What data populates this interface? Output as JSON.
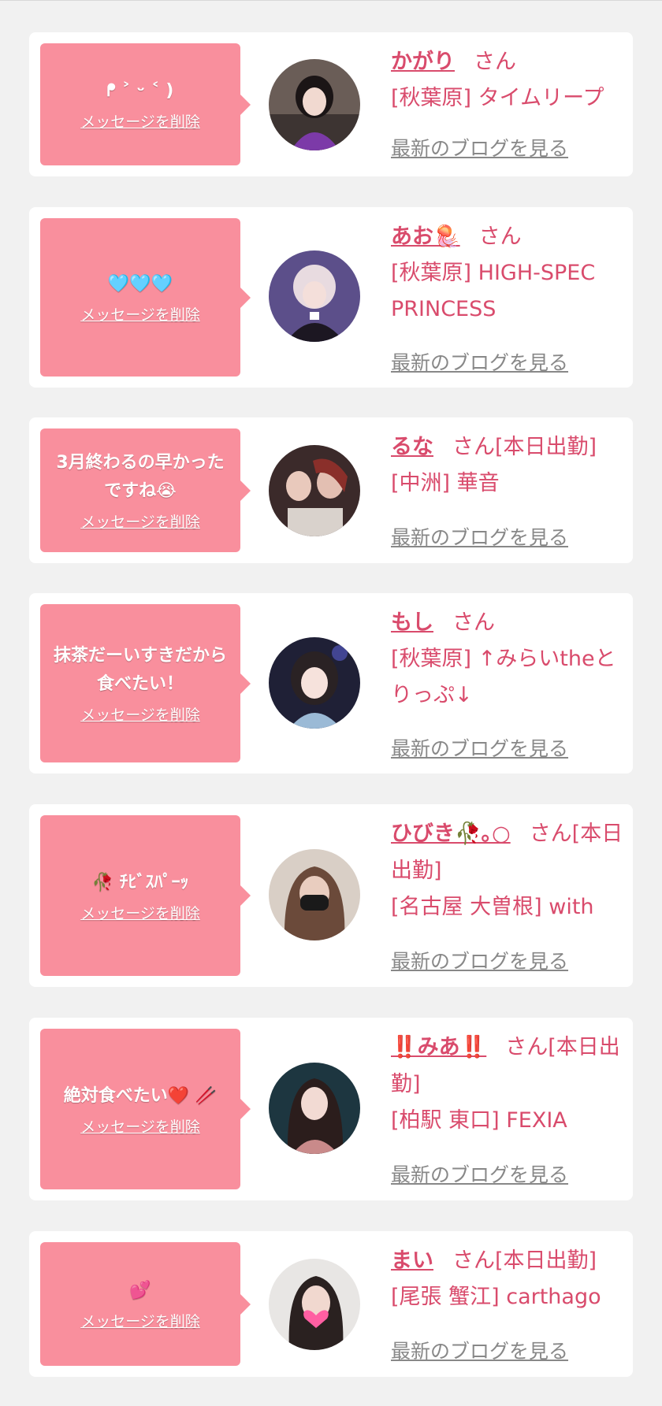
{
  "delete_label": "メッセージを削除",
  "blog_label": "最新のブログを見る",
  "colors": {
    "page_bg": "#f1f1f1",
    "card_bg": "#ffffff",
    "bubble": "#f98f9d",
    "name": "#d94b6c",
    "link": "#888888"
  },
  "entries": [
    {
      "message": "ᖰ ˃ ᵕ ˂ )",
      "name": "かがり",
      "suffix": "さん",
      "shop": "[秋葉原] タイムリープ"
    },
    {
      "message": "🩵🩵🩵",
      "name": "あお🪼",
      "suffix": "さん",
      "shop": "[秋葉原] HIGH-SPEC PRINCESS"
    },
    {
      "message": "3月終わるの早かったですね😭",
      "name": "るな",
      "suffix": "さん[本日出勤]",
      "shop": "[中洲] 華音"
    },
    {
      "message": "抹茶だーいすきだから食べたい！",
      "name": "もし",
      "suffix": "さん",
      "shop": "[秋葉原] ↑みらいtheとりっぷ↓"
    },
    {
      "message": "🥀 ﾁﾋﾞｽﾊﾟｰｯ",
      "name": "ひびき🥀｡○",
      "suffix": "さん[本日出勤]",
      "shop": "[名古屋 大曽根] with"
    },
    {
      "message": "絶対食べたい❤️ 🥢",
      "name": "‼️みあ‼️",
      "suffix": "さん[本日出勤]",
      "shop": "[柏駅 東口] FEXIA"
    },
    {
      "message": "💕",
      "name": "まい",
      "suffix": "さん[本日出勤]",
      "shop": "[尾張 蟹江] carthago"
    }
  ]
}
